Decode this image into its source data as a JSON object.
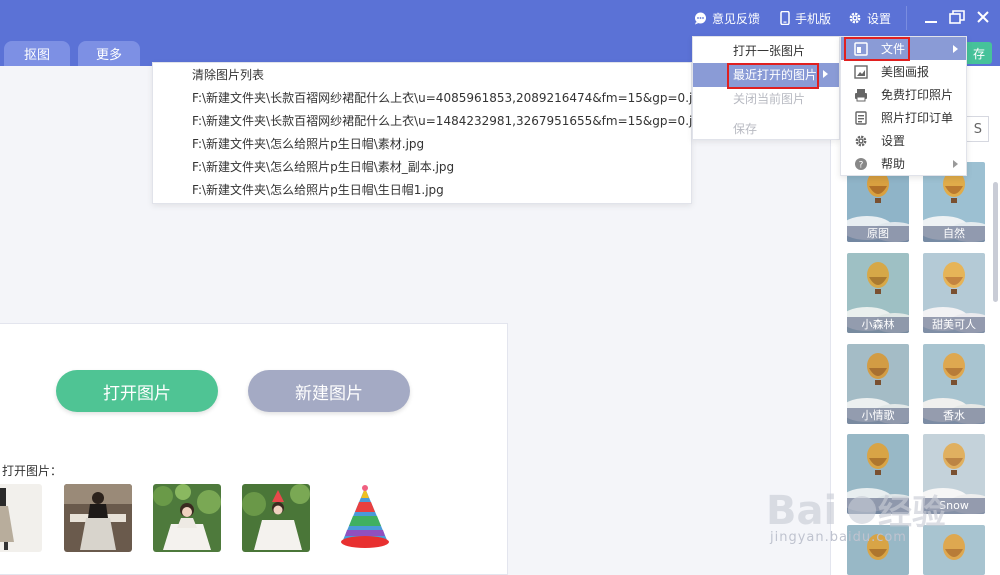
{
  "titlebar": {
    "feedback_label": "意见反馈",
    "mobile_label": "手机版",
    "settings_label": "设置"
  },
  "toolbar": {
    "tab_cutout": "抠图",
    "tab_more": "更多",
    "save_label": "存"
  },
  "main_menu": {
    "items": [
      {
        "label": "文件",
        "icon": "file-icon",
        "has_submenu": true,
        "active": true
      },
      {
        "label": "美图画报",
        "icon": "pictorial-icon"
      },
      {
        "label": "免费打印照片",
        "icon": "printer-icon"
      },
      {
        "label": "照片打印订单",
        "icon": "order-icon"
      },
      {
        "label": "设置",
        "icon": "gear-icon"
      },
      {
        "label": "帮助",
        "icon": "help-icon",
        "has_submenu": true
      }
    ]
  },
  "file_submenu": {
    "items": [
      {
        "label": "打开一张图片",
        "enabled": true
      },
      {
        "label": "最近打开的图片",
        "enabled": true,
        "active": true,
        "has_submenu": true
      },
      {
        "label": "关闭当前图片",
        "enabled": false
      },
      {
        "label": "保存",
        "enabled": false
      }
    ]
  },
  "recent_menu": {
    "items": [
      "清除图片列表",
      "F:\\新建文件夹\\长款百褶网纱裙配什么上衣\\u=4085961853,2089216474&fm=15&gp=0.jpg",
      "F:\\新建文件夹\\长款百褶网纱裙配什么上衣\\u=1484232981,3267951655&fm=15&gp=0.jpg",
      "F:\\新建文件夹\\怎么给照片p生日帽\\素材.jpg",
      "F:\\新建文件夹\\怎么给照片p生日帽\\素材_副本.jpg",
      "F:\\新建文件夹\\怎么给照片p生日帽\\生日帽1.jpg"
    ]
  },
  "start": {
    "open_label": "打开图片",
    "new_label": "新建图片",
    "recent_label": "打开图片："
  },
  "right_panel": {
    "s_label": "S",
    "filters": [
      "原图",
      "自然",
      "小森林",
      "甜美可人",
      "小情歌",
      "香水",
      "",
      "Snow"
    ]
  },
  "watermark": {
    "text": "jingyan.baidu.com"
  },
  "colors": {
    "brand_blue": "#5b72d6",
    "menu_highlight": "#8a9bd6",
    "primary_green": "#4fc494",
    "secondary_gray": "#a4aac4",
    "annotation_red": "#e02020"
  }
}
